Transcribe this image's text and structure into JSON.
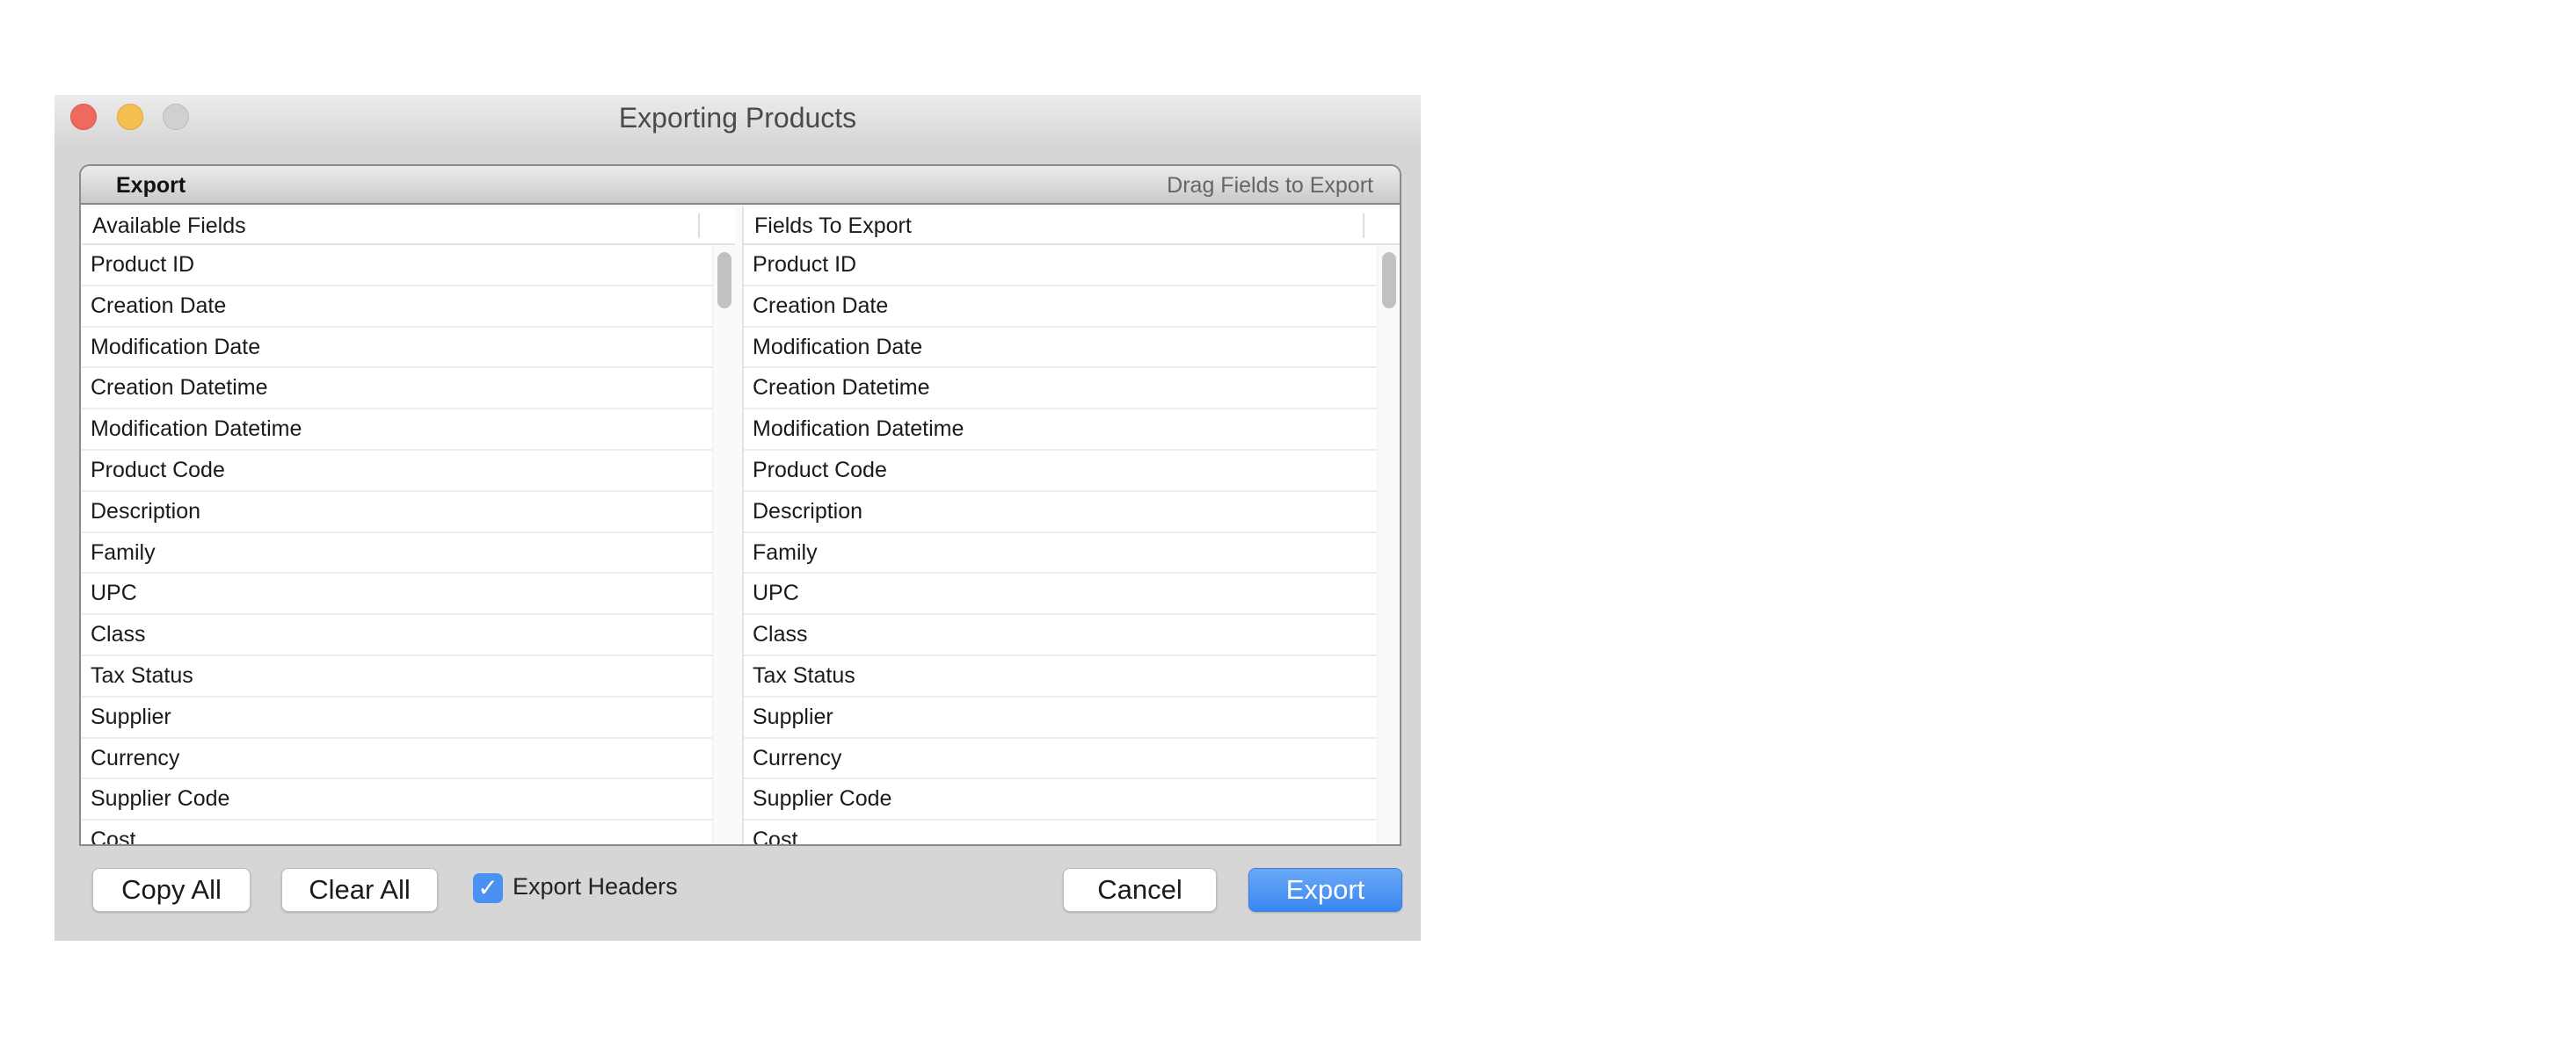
{
  "window": {
    "title": "Exporting Products",
    "traffic_lights": {
      "close": "#ee6a5f",
      "minimize": "#f5bf4f",
      "zoom": "#d0d0d0"
    }
  },
  "box": {
    "title": "Export",
    "hint": "Drag Fields to Export"
  },
  "available": {
    "header": "Available Fields",
    "items": [
      "Product ID",
      "Creation Date",
      "Modification Date",
      "Creation Datetime",
      "Modification Datetime",
      "Product Code",
      "Description",
      "Family",
      "UPC",
      "Class",
      "Tax Status",
      "Supplier",
      "Currency",
      "Supplier Code",
      "Cost"
    ]
  },
  "export_fields": {
    "header": "Fields To Export",
    "items": [
      "Product ID",
      "Creation Date",
      "Modification Date",
      "Creation Datetime",
      "Modification Datetime",
      "Product Code",
      "Description",
      "Family",
      "UPC",
      "Class",
      "Tax Status",
      "Supplier",
      "Currency",
      "Supplier Code",
      "Cost"
    ]
  },
  "footer": {
    "copy_all": "Copy All",
    "clear_all": "Clear All",
    "export_headers": "Export Headers",
    "export_headers_checked": true,
    "cancel": "Cancel",
    "export": "Export",
    "accent": "#3a86f2"
  }
}
